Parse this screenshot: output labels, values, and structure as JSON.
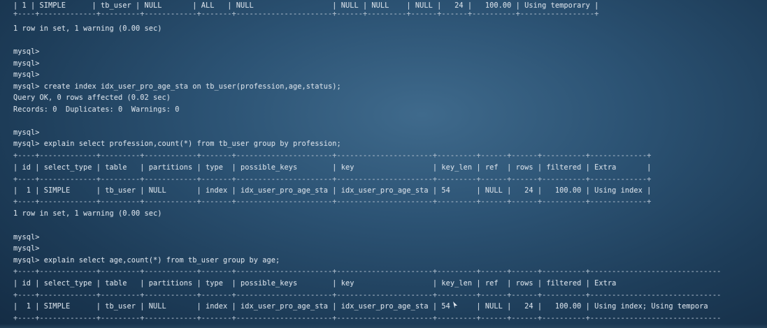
{
  "terminal": {
    "lines": [
      "| 1 | SIMPLE      | tb_user | NULL       | ALL   | NULL                  | NULL | NULL    | NULL |   24 |   100.00 | Using temporary |",
      "1 row in set, 1 warning (0.00 sec)",
      "mysql>",
      "mysql>",
      "mysql>",
      "mysql> create index idx_user_pro_age_sta on tb_user(profession,age,status);",
      "Query OK, 0 rows affected (0.02 sec)",
      "Records: 0  Duplicates: 0  Warnings: 0",
      "mysql>",
      "mysql> explain select profession,count(*) from tb_user group by profession;",
      "+----+-------------+---------+------------+-------+----------------------+----------------------+---------+------+------+----------+-------------+",
      "| id | select_type | table   | partitions | type  | possible_keys        | key                  | key_len | ref  | rows | filtered | Extra       |",
      "+----+-------------+---------+------------+-------+----------------------+----------------------+---------+------+------+----------+-------------+",
      "|  1 | SIMPLE      | tb_user | NULL       | index | idx_user_pro_age_sta | idx_user_pro_age_sta | 54      | NULL |   24 |   100.00 | Using index |",
      "+----+-------------+---------+------------+-------+----------------------+----------------------+---------+------+------+----------+-------------+",
      "1 row in set, 1 warning (0.00 sec)",
      "mysql>",
      "mysql>",
      "mysql> explain select age,count(*) from tb_user group by age;",
      "+----+-------------+---------+------------+-------+----------------------+----------------------+---------+------+------+----------+------------------------------",
      "| id | select_type | table   | partitions | type  | possible_keys        | key                  | key_len | ref  | rows | filtered | Extra",
      "+----+-------------+---------+------------+-------+----------------------+----------------------+---------+------+------+----------+------------------------------",
      "|  1 | SIMPLE      | tb_user | NULL       | index | idx_user_pro_age_sta | idx_user_pro_age_sta | 54      | NULL |   24 |   100.00 | Using index; Using tempora",
      "+----+-------------+---------+------------+-------+----------------------+----------------------+---------+------+------+----------+------------------------------"
    ],
    "top_separator": "+----+-------------+---------+------------+-------+----------------------+------+---------+------+------+----------+-----------------+"
  }
}
